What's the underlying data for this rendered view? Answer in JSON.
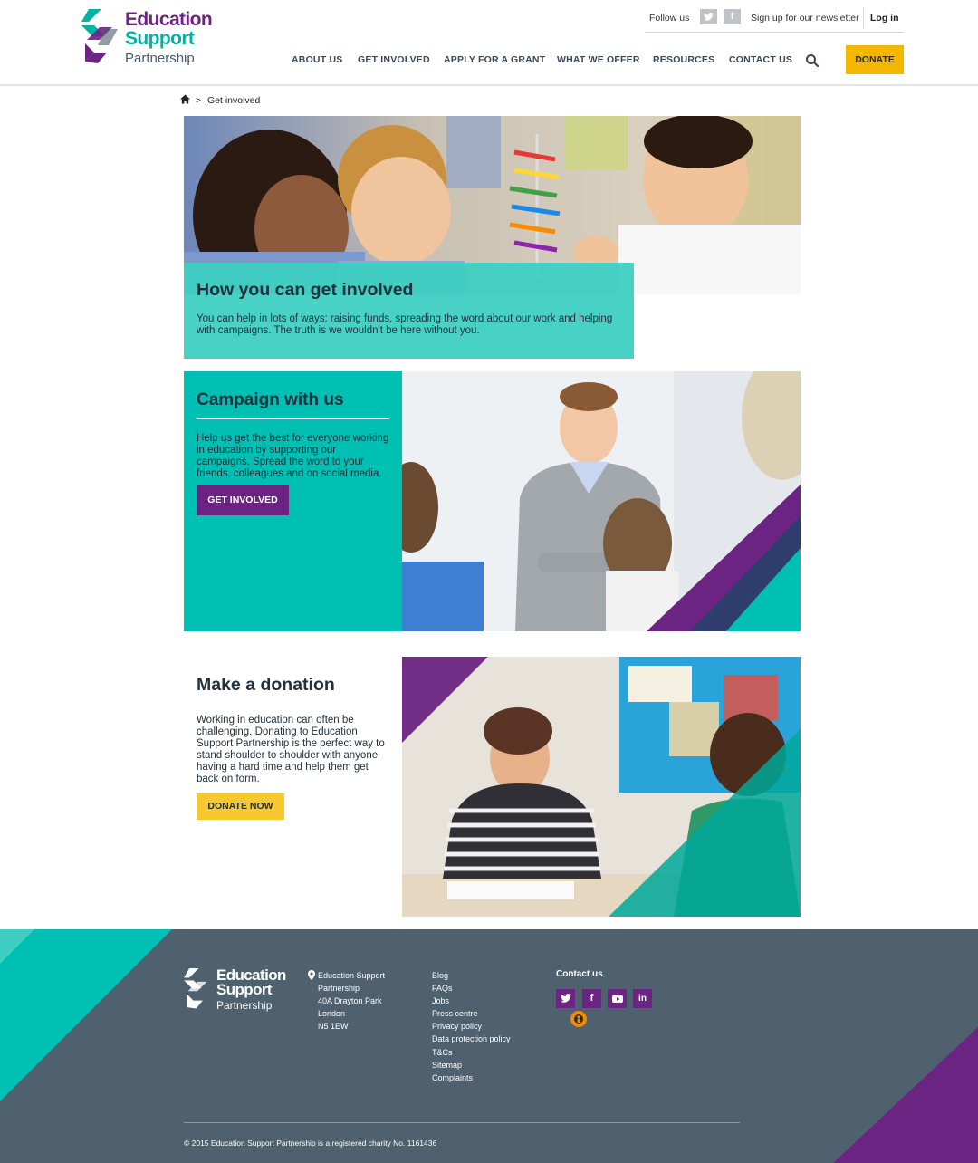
{
  "brand": {
    "line1": "Education",
    "line2": "Support",
    "line3": "Partnership",
    "colors": {
      "purple": "#6c2483",
      "teal": "#00bfb3",
      "yellow": "#f5b600",
      "slate": "#4f616e"
    }
  },
  "topbar": {
    "follow": "Follow us",
    "twitter_icon": "twitter-icon",
    "facebook_icon": "facebook-icon",
    "newsletter": "Sign up for our newsletter",
    "login": "Log in"
  },
  "nav": {
    "items": [
      "ABOUT US",
      "GET INVOLVED",
      "APPLY FOR A GRANT",
      "WHAT WE OFFER",
      "RESOURCES",
      "CONTACT US"
    ],
    "donate": "DONATE"
  },
  "breadcrumb": {
    "separator": ">",
    "current": "Get involved"
  },
  "hero": {
    "title": "How you can get involved",
    "text": "You can help in lots of ways: raising funds, spreading the word about our work and helping with campaigns. The truth is we wouldn't be here without you."
  },
  "campaign": {
    "title": "Campaign with us",
    "text": "Help us get the best for everyone working in education by supporting our campaigns. Spread the word to your friends, colleagues and on social media.",
    "button": "GET INVOLVED"
  },
  "donation": {
    "title": "Make a donation",
    "text": "Working in education can often be challenging. Donating to Education Support Partnership is the perfect way to stand shoulder to shoulder with anyone having a hard time and help them get back on form.",
    "button": "DONATE NOW"
  },
  "footer": {
    "logo": {
      "line1": "Education",
      "line2": "Support",
      "line3": "Partnership"
    },
    "address": [
      "Education Support",
      "Partnership",
      "40A Drayton Park",
      "London",
      "N5 1EW"
    ],
    "links": [
      "Blog",
      "FAQs",
      "Jobs",
      "Press centre",
      "Privacy policy",
      "Data protection policy",
      "T&Cs",
      "Sitemap",
      "Complaints"
    ],
    "contact_title": "Contact us",
    "social": [
      "twitter-icon",
      "facebook-icon",
      "youtube-icon",
      "linkedin-icon"
    ],
    "copyright": "© 2015 Education Support Partnership is a registered charity No. 1161436"
  }
}
